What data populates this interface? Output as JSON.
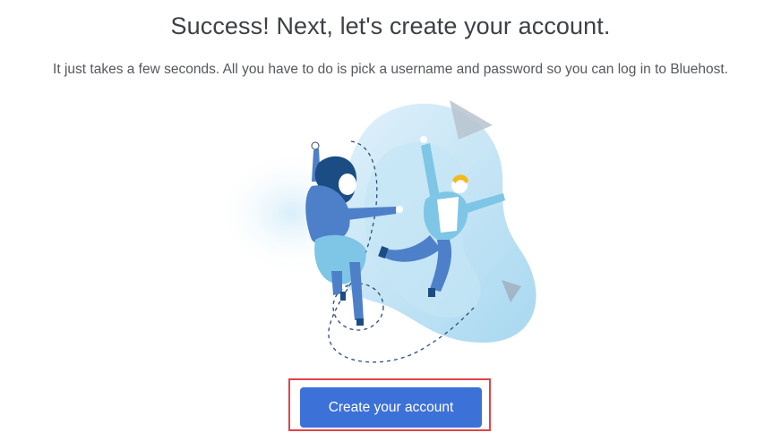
{
  "header": {
    "title": "Success! Next, let's create your account.",
    "subtitle": "It just takes a few seconds. All you have to do is pick a username and password so you can log in to Bluehost."
  },
  "illustration": {
    "icon": "celebrating-people-illustration",
    "colors": {
      "blob_light": "#d6ecf8",
      "blob_mid": "#a9d8f0",
      "figure_dark_blue": "#1c4c84",
      "figure_mid_blue": "#4d80c8",
      "figure_light_blue": "#7ec5e6",
      "hair_yellow": "#f4b81a",
      "triangle_gray": "#a9b6c3"
    }
  },
  "cta": {
    "label": "Create your account",
    "button_color": "#3c71d8",
    "highlight_color": "#e04449"
  }
}
